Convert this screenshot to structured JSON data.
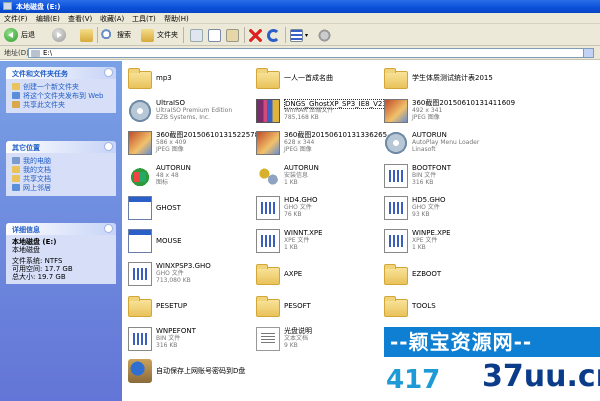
{
  "window": {
    "title": "本地磁盘 (E:)"
  },
  "menu": [
    "文件(F)",
    "编辑(E)",
    "查看(V)",
    "收藏(A)",
    "工具(T)",
    "帮助(H)"
  ],
  "toolbar": {
    "back": "后退",
    "search": "搜索",
    "folders": "文件夹"
  },
  "address": {
    "label": "地址(D)",
    "value": "E:\\"
  },
  "tasks": {
    "file_title": "文件和文件夹任务",
    "file_links": [
      "创建一个新文件夹",
      "将这个文件夹发布到 Web",
      "共享此文件夹"
    ],
    "other_title": "其它位置",
    "other_links": [
      "我的电脑",
      "我的文档",
      "共享文档",
      "网上邻居"
    ],
    "detail_title": "详细信息",
    "detail_name": "本地磁盘 (E:)",
    "detail_type": "本地磁盘",
    "detail_fs": "文件系统: NTFS",
    "detail_free": "可用空间: 17.7 GB",
    "detail_total": "总大小: 19.7 GB"
  },
  "files": [
    {
      "name": "mp3",
      "l1": "",
      "l2": "",
      "icon": "folder-icon"
    },
    {
      "name": "一人一首成名曲",
      "l1": "",
      "l2": "",
      "icon": "folder-icon"
    },
    {
      "name": "学生体质测试统计表2015",
      "l1": "",
      "l2": "",
      "icon": "folder-icon"
    },
    {
      "name": "UltraISO",
      "l1": "UltraISO Premium Edition",
      "l2": "EZB Systems, Inc.",
      "icon": "disc-icon"
    },
    {
      "name": "DNGS_GhostXP_SP3_IE8_V23.9",
      "l1": "WinRAR 压缩文件",
      "l2": "785,168 KB",
      "icon": "rar-icon"
    },
    {
      "name": "360截图20150610131411609",
      "l1": "492 x 341",
      "l2": "JPEG 图像",
      "icon": "jpeg-icon"
    },
    {
      "name": "360截图20150610131522578",
      "l1": "586 x 409",
      "l2": "JPEG 图像",
      "icon": "jpeg-icon"
    },
    {
      "name": "360截图20150610131336265",
      "l1": "628 x 344",
      "l2": "JPEG 图像",
      "icon": "jpeg-icon"
    },
    {
      "name": "AUTORUN",
      "l1": "AutoPlay Menu Loader",
      "l2": "Linasoft",
      "icon": "disc-icon"
    },
    {
      "name": "AUTORUN",
      "l1": "48 x 48",
      "l2": "图标",
      "icon": "xp-icon"
    },
    {
      "name": "AUTORUN",
      "l1": "安装信息",
      "l2": "1 KB",
      "icon": "gears-icon"
    },
    {
      "name": "BOOTFONT",
      "l1": "BIN 文件",
      "l2": "316 KB",
      "icon": "gho-file-icon"
    },
    {
      "name": "GHOST",
      "l1": "",
      "l2": "",
      "icon": "window-app-icon"
    },
    {
      "name": "HD4.GHO",
      "l1": "GHO 文件",
      "l2": "76 KB",
      "icon": "gho-file-icon"
    },
    {
      "name": "HD5.GHO",
      "l1": "GHO 文件",
      "l2": "93 KB",
      "icon": "gho-file-icon"
    },
    {
      "name": "MOUSE",
      "l1": "",
      "l2": "",
      "icon": "window-app-icon"
    },
    {
      "name": "WINNT.XPE",
      "l1": "XPE 文件",
      "l2": "1 KB",
      "icon": "gho-file-icon"
    },
    {
      "name": "WINPE.XPE",
      "l1": "XPE 文件",
      "l2": "1 KB",
      "icon": "gho-file-icon"
    },
    {
      "name": "WINXPSP3.GHO",
      "l1": "GHO 文件",
      "l2": "713,080 KB",
      "icon": "gho-file-icon"
    },
    {
      "name": "AXPE",
      "l1": "",
      "l2": "",
      "icon": "folder-icon"
    },
    {
      "name": "EZBOOT",
      "l1": "",
      "l2": "",
      "icon": "folder-icon"
    },
    {
      "name": "PESETUP",
      "l1": "",
      "l2": "",
      "icon": "folder-icon"
    },
    {
      "name": "PESOFT",
      "l1": "",
      "l2": "",
      "icon": "folder-icon"
    },
    {
      "name": "TOOLS",
      "l1": "",
      "l2": "",
      "icon": "folder-icon"
    },
    {
      "name": "WNPEFONT",
      "l1": "BIN 文件",
      "l2": "316 KB",
      "icon": "gho-file-icon"
    },
    {
      "name": "光盘说明",
      "l1": "文本文档",
      "l2": "9 KB",
      "icon": "text-file-icon"
    },
    {
      "name": "",
      "l1": "",
      "l2": "",
      "icon": ""
    },
    {
      "name": "自动保存上网账号密码到D盘",
      "l1": "",
      "l2": "",
      "icon": "setup-icon"
    }
  ],
  "watermark": {
    "line1": "--颖宝资源网--",
    "line2a": "417",
    "line2b": "37uu.cn"
  }
}
